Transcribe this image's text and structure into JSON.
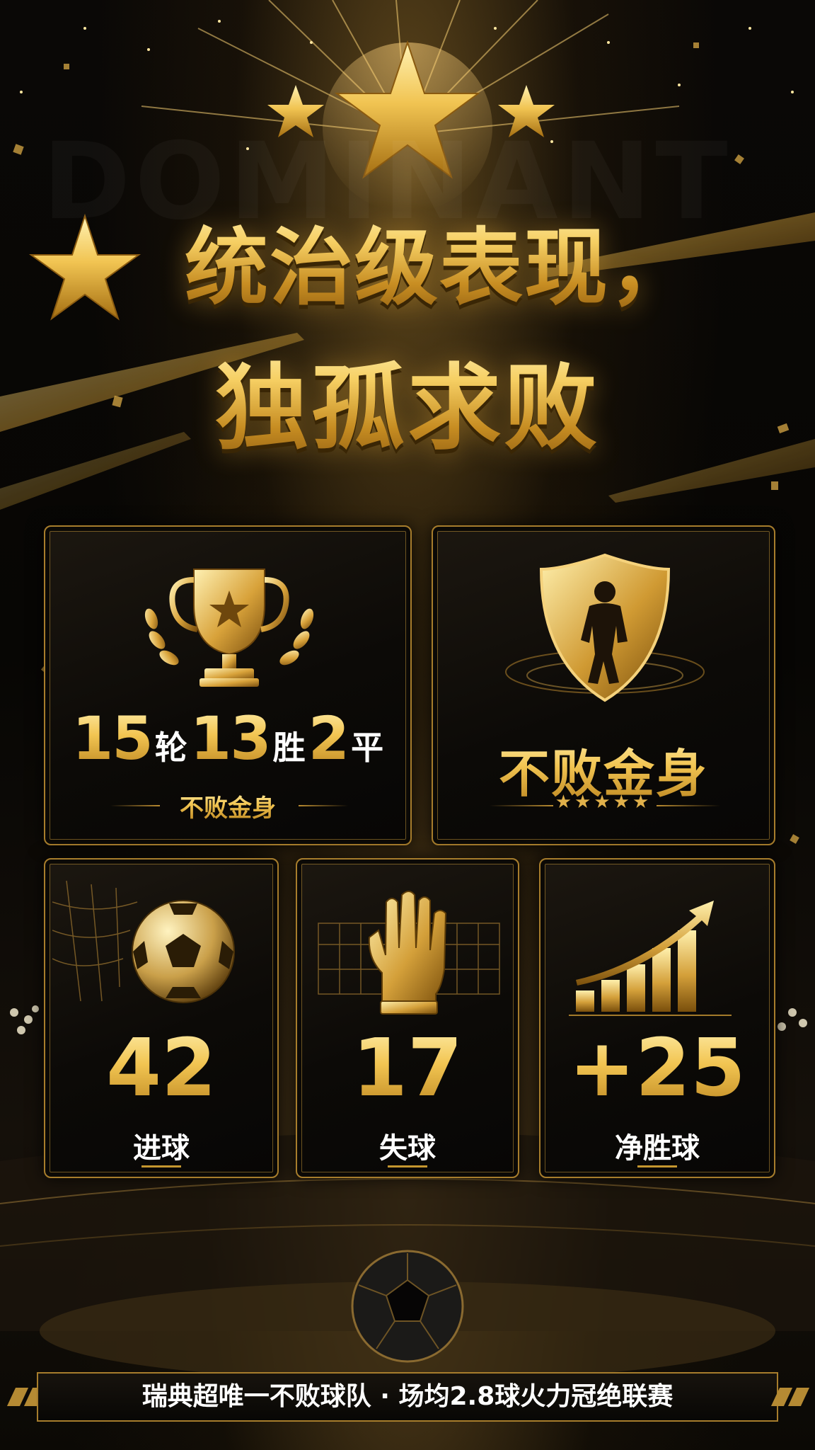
{
  "poster": {
    "background_word": "DOMINANT",
    "title_line1": "统治级表现，",
    "title_line2": "独孤求败"
  },
  "cards": {
    "record": {
      "icon": "trophy-icon",
      "rounds_number": "15",
      "rounds_unit": "轮",
      "wins_number": "13",
      "wins_unit": "胜",
      "draws_number": "2",
      "draws_unit": "平",
      "subtitle": "不败金身"
    },
    "unbeaten": {
      "icon": "shield-player-icon",
      "title": "不败金身",
      "stars": "★★★★★"
    },
    "goals_for": {
      "icon": "soccer-ball-net-icon",
      "value": "42",
      "label": "进球"
    },
    "goals_against": {
      "icon": "goalkeeper-glove-icon",
      "value": "17",
      "label": "失球"
    },
    "goal_difference": {
      "icon": "growth-bars-icon",
      "value": "+25",
      "label": "净胜球"
    }
  },
  "banner": {
    "text": "瑞典超唯一不败球队 · 场均2.8球火力冠绝联赛"
  },
  "colors": {
    "gold": "#f0c24e",
    "dark_gold": "#a77d2c",
    "background": "#050403",
    "white": "#ffffff"
  }
}
